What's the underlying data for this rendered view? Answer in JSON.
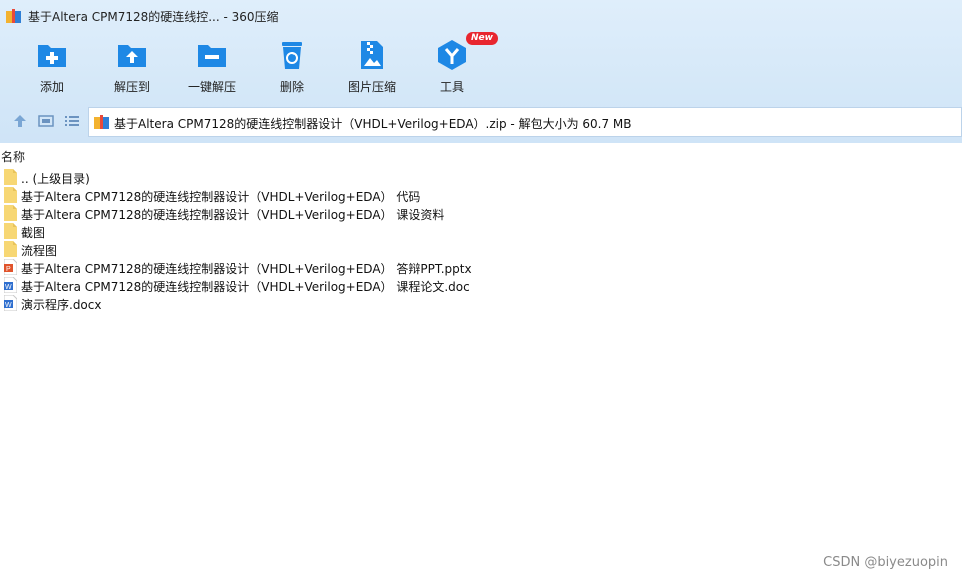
{
  "window": {
    "title": "基于Altera CPM7128的硬连线控... - 360压缩"
  },
  "toolbar": {
    "items": [
      {
        "label": "添加",
        "icon": "add-folder-icon"
      },
      {
        "label": "解压到",
        "icon": "extract-folder-icon"
      },
      {
        "label": "一键解压",
        "icon": "one-click-extract-icon"
      },
      {
        "label": "删除",
        "icon": "recycle-bin-icon"
      },
      {
        "label": "图片压缩",
        "icon": "image-compress-icon"
      },
      {
        "label": "工具",
        "icon": "tools-icon",
        "badge": "New"
      }
    ]
  },
  "nav": {
    "path": "基于Altera CPM7128的硬连线控制器设计（VHDL+Verilog+EDA）.zip - 解包大小为 60.7 MB"
  },
  "list": {
    "header": "名称",
    "items": [
      {
        "name": ".. (上级目录)",
        "type": "folder"
      },
      {
        "name": "基于Altera CPM7128的硬连线控制器设计（VHDL+Verilog+EDA） 代码",
        "type": "folder"
      },
      {
        "name": "基于Altera CPM7128的硬连线控制器设计（VHDL+Verilog+EDA） 课设资料",
        "type": "folder"
      },
      {
        "name": "截图",
        "type": "folder"
      },
      {
        "name": "流程图",
        "type": "folder"
      },
      {
        "name": "基于Altera CPM7128的硬连线控制器设计（VHDL+Verilog+EDA） 答辩PPT.pptx",
        "type": "pptx"
      },
      {
        "name": "基于Altera CPM7128的硬连线控制器设计（VHDL+Verilog+EDA） 课程论文.doc",
        "type": "doc"
      },
      {
        "name": "演示程序.docx",
        "type": "docx"
      }
    ]
  },
  "watermark": "CSDN @biyezuopin",
  "colors": {
    "chrome": "#d5e8f8",
    "accent": "#1e88e5",
    "folder": "#f7d774",
    "badge": "#e8262f"
  }
}
